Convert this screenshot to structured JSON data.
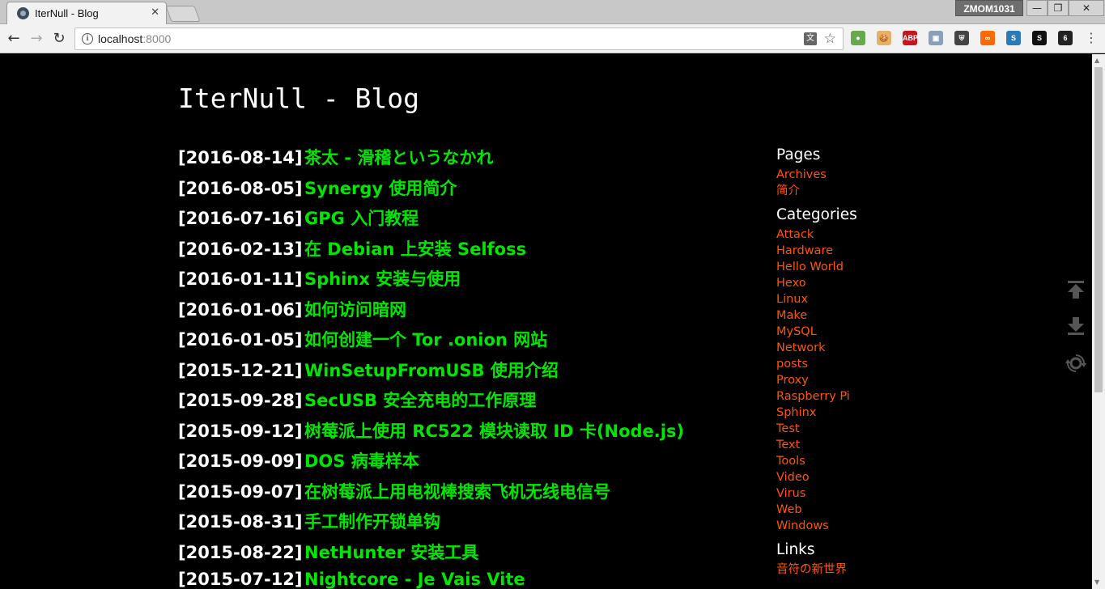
{
  "browser": {
    "tab_title": "IterNull - Blog",
    "tab_close": "✕",
    "profile_name": "ZMOM1031",
    "url_host": "localhost",
    "url_port": ":8000",
    "translate_label": "文",
    "win_min": "—",
    "win_max": "❐",
    "win_close": "✕",
    "extensions": [
      {
        "label": "●",
        "color": "#6aa84f"
      },
      {
        "label": "🍪",
        "color": "#e2b26b"
      },
      {
        "label": "ABP",
        "color": "#c4161c"
      },
      {
        "label": "▣",
        "color": "#8aa0b8"
      },
      {
        "label": "⛨",
        "color": "#444444"
      },
      {
        "label": "∞",
        "color": "#ff6a00"
      },
      {
        "label": "S",
        "color": "#2a7ab8"
      },
      {
        "label": "S",
        "color": "#111111"
      },
      {
        "label": "6",
        "color": "#222222"
      }
    ]
  },
  "site": {
    "title": "IterNull - Blog"
  },
  "posts": [
    {
      "date": "[2016-08-14]",
      "title": "茶太 - 滑稽というなかれ"
    },
    {
      "date": "[2016-08-05]",
      "title": "Synergy 使用简介"
    },
    {
      "date": "[2016-07-16]",
      "title": "GPG 入门教程"
    },
    {
      "date": "[2016-02-13]",
      "title": "在 Debian 上安装 Selfoss"
    },
    {
      "date": "[2016-01-11]",
      "title": "Sphinx 安装与使用"
    },
    {
      "date": "[2016-01-06]",
      "title": "如何访问暗网"
    },
    {
      "date": "[2016-01-05]",
      "title": "如何创建一个 Tor .onion 网站"
    },
    {
      "date": "[2015-12-21]",
      "title": "WinSetupFromUSB 使用介绍"
    },
    {
      "date": "[2015-09-28]",
      "title": "SecUSB 安全充电的工作原理"
    },
    {
      "date": "[2015-09-12]",
      "title": "树莓派上使用 RC522 模块读取 ID 卡(Node.js)"
    },
    {
      "date": "[2015-09-09]",
      "title": "DOS 病毒样本"
    },
    {
      "date": "[2015-09-07]",
      "title": "在树莓派上用电视棒搜索飞机无线电信号"
    },
    {
      "date": "[2015-08-31]",
      "title": "手工制作开锁单钩"
    },
    {
      "date": "[2015-08-22]",
      "title": "NetHunter 安装工具"
    },
    {
      "date": "[2015-07-12]",
      "title": "Nightcore - Je Vais Vite"
    }
  ],
  "sidebar": {
    "pages_heading": "Pages",
    "pages": [
      "Archives",
      "简介"
    ],
    "categories_heading": "Categories",
    "categories": [
      "Attack",
      "Hardware",
      "Hello World",
      "Hexo",
      "Linux",
      "Make",
      "MySQL",
      "Network",
      "posts",
      "Proxy",
      "Raspberry Pi",
      "Sphinx",
      "Test",
      "Text",
      "Tools",
      "Video",
      "Virus",
      "Web",
      "Windows"
    ],
    "links_heading": "Links",
    "links": [
      "音符の新世界"
    ]
  }
}
